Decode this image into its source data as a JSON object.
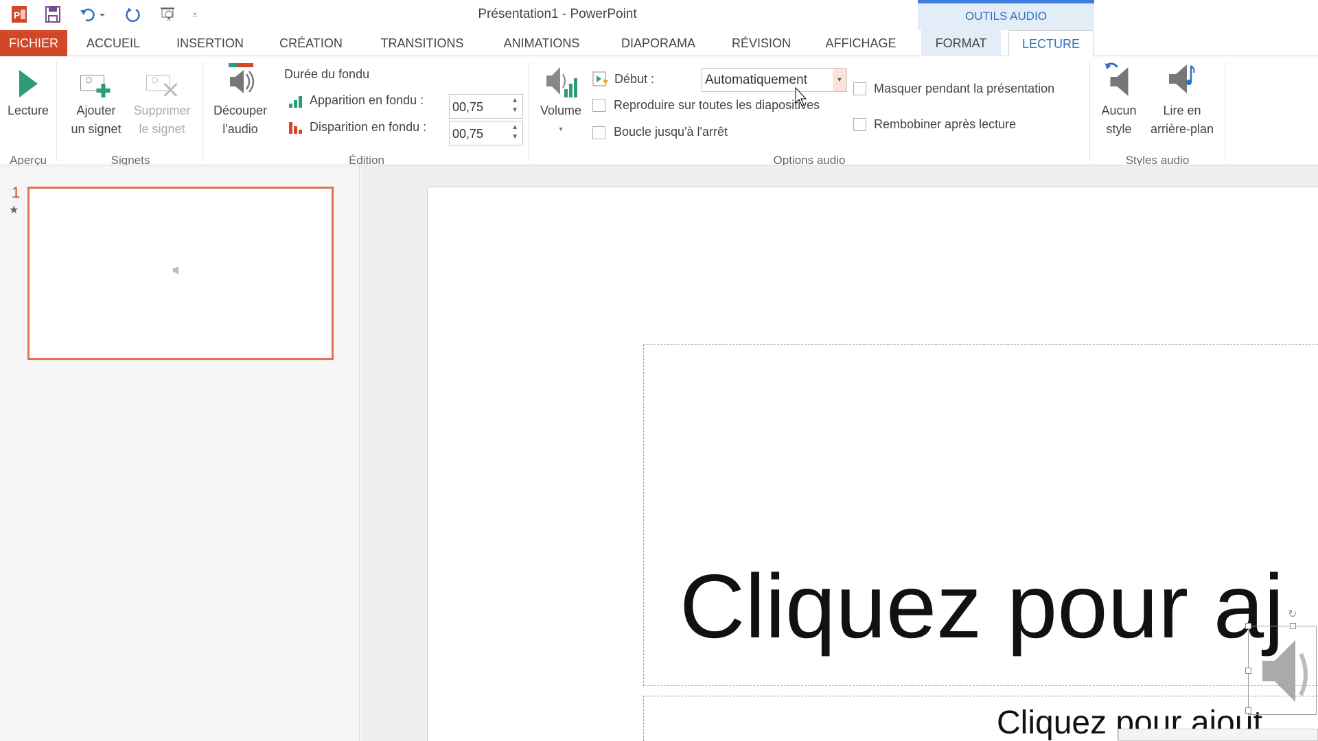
{
  "window": {
    "title": "Présentation1 - PowerPoint",
    "contextual_group": "OUTILS AUDIO"
  },
  "quick_access": [
    "powerpoint-logo",
    "save-icon",
    "undo-icon",
    "redo-icon",
    "start-slideshow-icon",
    "customize-icon"
  ],
  "tabs": [
    "FICHIER",
    "ACCUEIL",
    "INSERTION",
    "CRÉATION",
    "TRANSITIONS",
    "ANIMATIONS",
    "DIAPORAMA",
    "RÉVISION",
    "AFFICHAGE",
    "FORMAT",
    "LECTURE"
  ],
  "active_tab": "LECTURE",
  "ribbon": {
    "apercu": {
      "label": "Aperçu",
      "lecture": "Lecture"
    },
    "signets": {
      "label": "Signets",
      "ajouter": [
        "Ajouter",
        "un signet"
      ],
      "supprimer": [
        "Supprimer",
        "le signet"
      ]
    },
    "edition": {
      "label": "Édition",
      "decouper": [
        "Découper",
        "l'audio"
      ],
      "duree": "Durée du fondu",
      "apparition_label": "Apparition en fondu :",
      "apparition_value": "00,75",
      "disparition_label": "Disparition en fondu :",
      "disparition_value": "00,75"
    },
    "options": {
      "label": "Options audio",
      "volume": "Volume",
      "debut_label": "Début :",
      "debut_value": "Automatiquement",
      "reproduire": "Reproduire sur toutes les diapositives",
      "reproduire_checked": false,
      "boucle": "Boucle jusqu'à l'arrêt",
      "boucle_checked": false,
      "masquer": "Masquer pendant la présentation",
      "masquer_checked": false,
      "rembobiner": "Rembobiner après lecture",
      "rembobiner_checked": false
    },
    "styles": {
      "label": "Styles audio",
      "aucun": [
        "Aucun",
        "style"
      ],
      "arriere": [
        "Lire en",
        "arrière-plan"
      ]
    }
  },
  "slides_panel": {
    "slide_number": "1",
    "star": "★"
  },
  "slide": {
    "title_placeholder": "Cliquez pour aj",
    "subtitle_placeholder": "Cliquez pour ajout"
  },
  "colors": {
    "file_tab": "#d24726",
    "contextual": "#3b7dd8",
    "accent_green": "#2e9b7b",
    "thumb_border": "#e07350"
  }
}
